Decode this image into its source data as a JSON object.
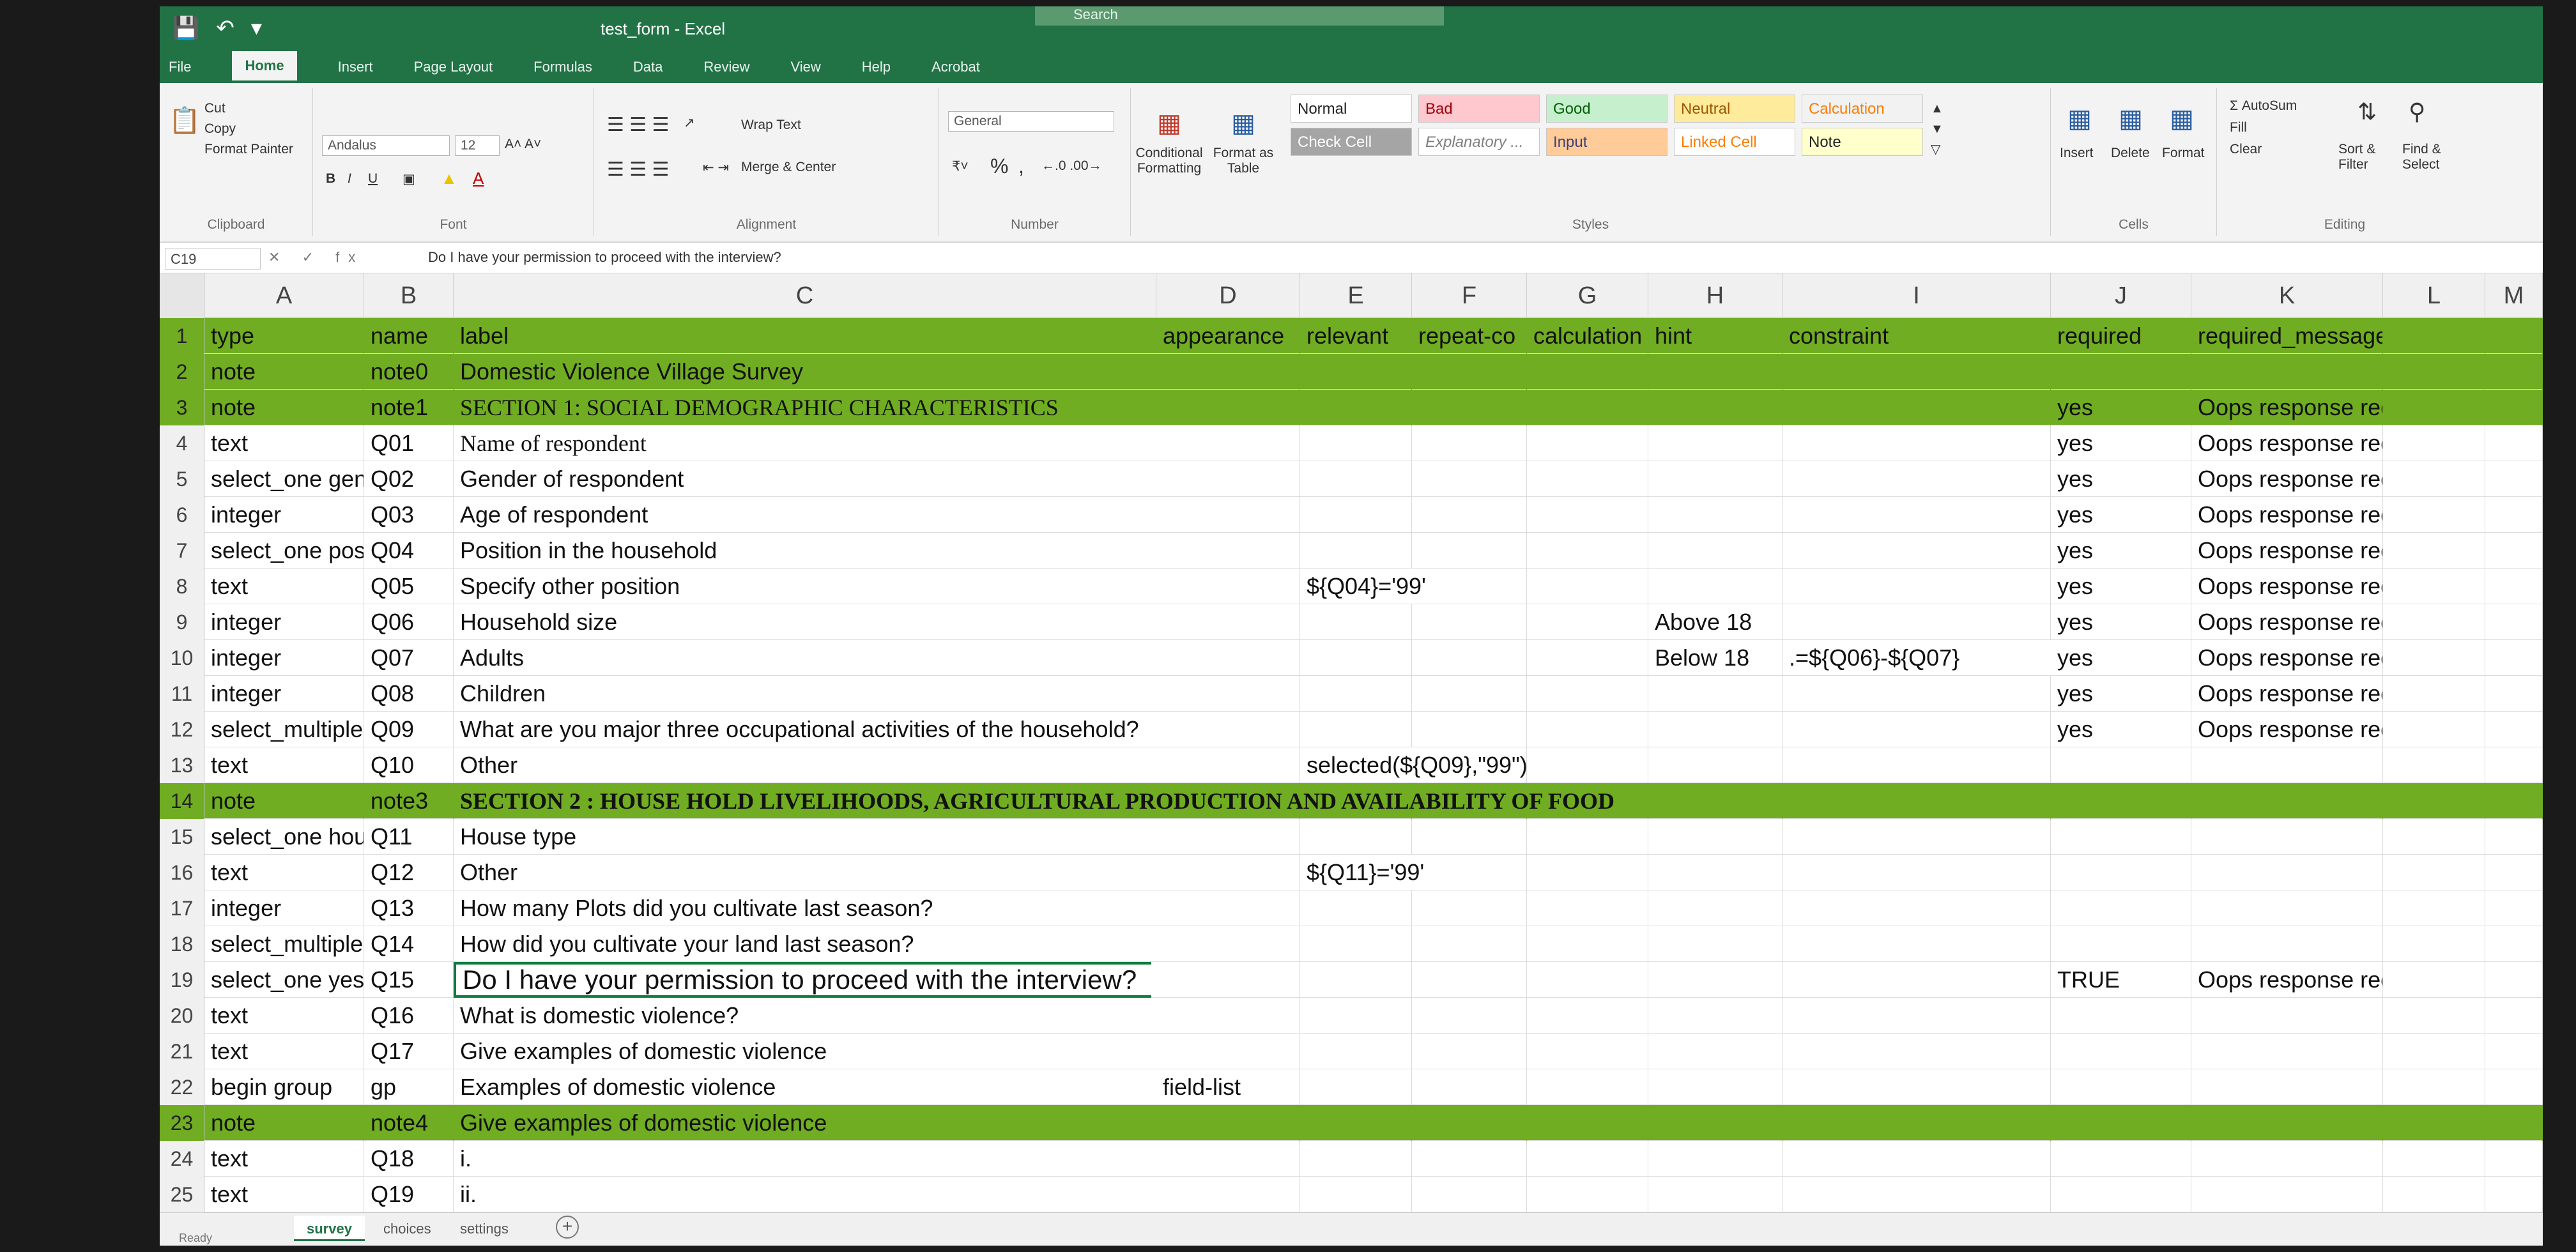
{
  "window": {
    "title": "test_form - Excel",
    "search_placeholder": "Search"
  },
  "qat": {
    "save_icon": "save-icon",
    "undo_icon": "undo-icon"
  },
  "tabs": [
    "File",
    "Home",
    "Insert",
    "Page Layout",
    "Formulas",
    "Data",
    "Review",
    "View",
    "Help",
    "Acrobat"
  ],
  "ribbon": {
    "clipboard": {
      "cut": "Cut",
      "copy": "Copy",
      "format_painter": "Format Painter",
      "title": "Clipboard"
    },
    "font": {
      "name": "Andalus",
      "size": "12",
      "title": "Font",
      "bold": "B",
      "italic": "I",
      "underline": "U"
    },
    "alignment": {
      "wrap": "Wrap Text",
      "merge": "Merge & Center",
      "title": "Alignment"
    },
    "number": {
      "format": "General",
      "percent": "%",
      "comma": ",",
      "title": "Number"
    },
    "styles": {
      "conditional": "Conditional Formatting",
      "format_table": "Format as Table",
      "title": "Styles",
      "cells": [
        {
          "label": "Normal",
          "bg": "#ffffff",
          "fg": "#222222"
        },
        {
          "label": "Bad",
          "bg": "#ffc7ce",
          "fg": "#9c0006"
        },
        {
          "label": "Good",
          "bg": "#c6efce",
          "fg": "#006100"
        },
        {
          "label": "Neutral",
          "bg": "#ffeb9c",
          "fg": "#9c5700"
        },
        {
          "label": "Calculation",
          "bg": "#f2f2f2",
          "fg": "#fa7d00"
        },
        {
          "label": "Check Cell",
          "bg": "#a5a5a5",
          "fg": "#ffffff"
        },
        {
          "label": "Explanatory ...",
          "bg": "#ffffff",
          "fg": "#7f7f7f"
        },
        {
          "label": "Input",
          "bg": "#ffcc99",
          "fg": "#3f3f76"
        },
        {
          "label": "Linked Cell",
          "bg": "#ffffff",
          "fg": "#fa7d00"
        },
        {
          "label": "Note",
          "bg": "#ffffcc",
          "fg": "#222222"
        }
      ]
    },
    "cells_group": {
      "insert": "Insert",
      "delete": "Delete",
      "format": "Format",
      "title": "Cells"
    },
    "editing": {
      "autosum": "AutoSum",
      "fill": "Fill",
      "clear": "Clear",
      "sort": "Sort & Filter",
      "find": "Find & Select",
      "title": "Editing"
    }
  },
  "formula_bar": {
    "name_box": "C19",
    "content": "Do I have your permission to proceed with the interview?"
  },
  "columns": [
    "A",
    "B",
    "C",
    "D",
    "E",
    "F",
    "G",
    "H",
    "I",
    "J",
    "K",
    "L",
    "M"
  ],
  "rows": [
    {
      "n": "1",
      "green": true,
      "cells": [
        "type",
        "name",
        "label",
        "appearance",
        "relevant",
        "repeat-co",
        "calculation",
        "hint",
        "constraint",
        "required",
        "required_message",
        "",
        ""
      ]
    },
    {
      "n": "2",
      "green": true,
      "cells": [
        "note",
        "note0",
        "Domestic Violence Village Survey",
        "",
        "",
        "",
        "",
        "",
        "",
        "",
        "",
        "",
        ""
      ]
    },
    {
      "n": "3",
      "green": true,
      "cells": [
        "note",
        "note1",
        "SECTION 1: SOCIAL DEMOGRAPHIC CHARACTERISTICS",
        "",
        "",
        "",
        "",
        "",
        "",
        "yes",
        "Oops response required",
        "",
        ""
      ]
    },
    {
      "n": "4",
      "cells": [
        "text",
        "Q01",
        "Name of respondent",
        "",
        "",
        "",
        "",
        "",
        "",
        "yes",
        "Oops response required",
        "",
        ""
      ]
    },
    {
      "n": "5",
      "cells": [
        "select_one gender",
        "Q02",
        "Gender of respondent",
        "",
        "",
        "",
        "",
        "",
        "",
        "yes",
        "Oops response required",
        "",
        ""
      ]
    },
    {
      "n": "6",
      "cells": [
        "integer",
        "Q03",
        "Age of respondent",
        "",
        "",
        "",
        "",
        "",
        "",
        "yes",
        "Oops response required",
        "",
        ""
      ]
    },
    {
      "n": "7",
      "cells": [
        "select_one position",
        "Q04",
        "Position in the household",
        "",
        "",
        "",
        "",
        "",
        "",
        "yes",
        "Oops response required",
        "",
        ""
      ]
    },
    {
      "n": "8",
      "cells": [
        "text",
        "Q05",
        "Specify other position",
        "",
        "${Q04}='99'",
        "",
        "",
        "",
        "",
        "yes",
        "Oops response required",
        "",
        ""
      ]
    },
    {
      "n": "9",
      "cells": [
        "integer",
        "Q06",
        "Household size",
        "",
        "",
        "",
        "",
        "Above 18",
        "",
        "yes",
        "Oops response required",
        "",
        ""
      ]
    },
    {
      "n": "10",
      "cells": [
        "integer",
        "Q07",
        "Adults",
        "",
        "",
        "",
        "",
        "Below 18",
        ".=${Q06}-${Q07}",
        "yes",
        "Oops response required",
        "",
        ""
      ]
    },
    {
      "n": "11",
      "cells": [
        "integer",
        "Q08",
        "Children",
        "",
        "",
        "",
        "",
        "",
        "",
        "yes",
        "Oops response required",
        "",
        ""
      ]
    },
    {
      "n": "12",
      "cells": [
        "select_multiple occu",
        "Q09",
        "What are you major three occupational activities of the household?",
        "",
        "",
        "",
        "",
        "",
        "",
        "yes",
        "Oops response required",
        "",
        ""
      ]
    },
    {
      "n": "13",
      "cells": [
        "text",
        "Q10",
        "Other",
        "",
        "selected(${Q09},\"99\")",
        "",
        "",
        "",
        "",
        "",
        "",
        "",
        ""
      ]
    },
    {
      "n": "14",
      "green": true,
      "cells": [
        "note",
        "note3",
        "SECTION 2 : HOUSE HOLD LIVELIHOODS, AGRICULTURAL PRODUCTION AND AVAILABILITY OF FOOD",
        "",
        "",
        "",
        "",
        "",
        "",
        "",
        "",
        "",
        ""
      ]
    },
    {
      "n": "15",
      "cells": [
        "select_one house",
        "Q11",
        "House type",
        "",
        "",
        "",
        "",
        "",
        "",
        "",
        "",
        "",
        ""
      ]
    },
    {
      "n": "16",
      "cells": [
        "text",
        "Q12",
        "Other",
        "",
        "${Q11}='99'",
        "",
        "",
        "",
        "",
        "",
        "",
        "",
        ""
      ]
    },
    {
      "n": "17",
      "cells": [
        "integer",
        "Q13",
        "How many Plots did you cultivate last season?",
        "",
        "",
        "",
        "",
        "",
        "",
        "",
        "",
        "",
        ""
      ]
    },
    {
      "n": "18",
      "cells": [
        "select_multiple cult",
        "Q14",
        "How did you cultivate your land last season?",
        "",
        "",
        "",
        "",
        "",
        "",
        "",
        "",
        "",
        ""
      ]
    },
    {
      "n": "19",
      "cells": [
        "select_one yesno",
        "Q15",
        "Do I have your permission to proceed with the interview?",
        "",
        "",
        "",
        "",
        "",
        "",
        "TRUE",
        "Oops response required",
        "",
        ""
      ]
    },
    {
      "n": "20",
      "cells": [
        "text",
        "Q16",
        "What is domestic violence?",
        "",
        "",
        "",
        "",
        "",
        "",
        "",
        "",
        "",
        ""
      ]
    },
    {
      "n": "21",
      "cells": [
        "text",
        "Q17",
        "Give examples of domestic violence",
        "",
        "",
        "",
        "",
        "",
        "",
        "",
        "",
        "",
        ""
      ]
    },
    {
      "n": "22",
      "cells": [
        "begin group",
        "gp",
        "Examples of domestic violence",
        "field-list",
        "",
        "",
        "",
        "",
        "",
        "",
        "",
        "",
        ""
      ]
    },
    {
      "n": "23",
      "green": true,
      "cells": [
        "note",
        "note4",
        "Give examples of domestic violence",
        "",
        "",
        "",
        "",
        "",
        "",
        "",
        "",
        "",
        ""
      ]
    },
    {
      "n": "24",
      "cells": [
        "text",
        "Q18",
        "i.",
        "",
        "",
        "",
        "",
        "",
        "",
        "",
        "",
        "",
        ""
      ]
    },
    {
      "n": "25",
      "cells": [
        "text",
        "Q19",
        "ii.",
        "",
        "",
        "",
        "",
        "",
        "",
        "",
        "",
        "",
        ""
      ]
    }
  ],
  "sheets": [
    "survey",
    "choices",
    "settings"
  ],
  "status": "Ready",
  "accent": "#217346",
  "section_fill": "#70ad22"
}
